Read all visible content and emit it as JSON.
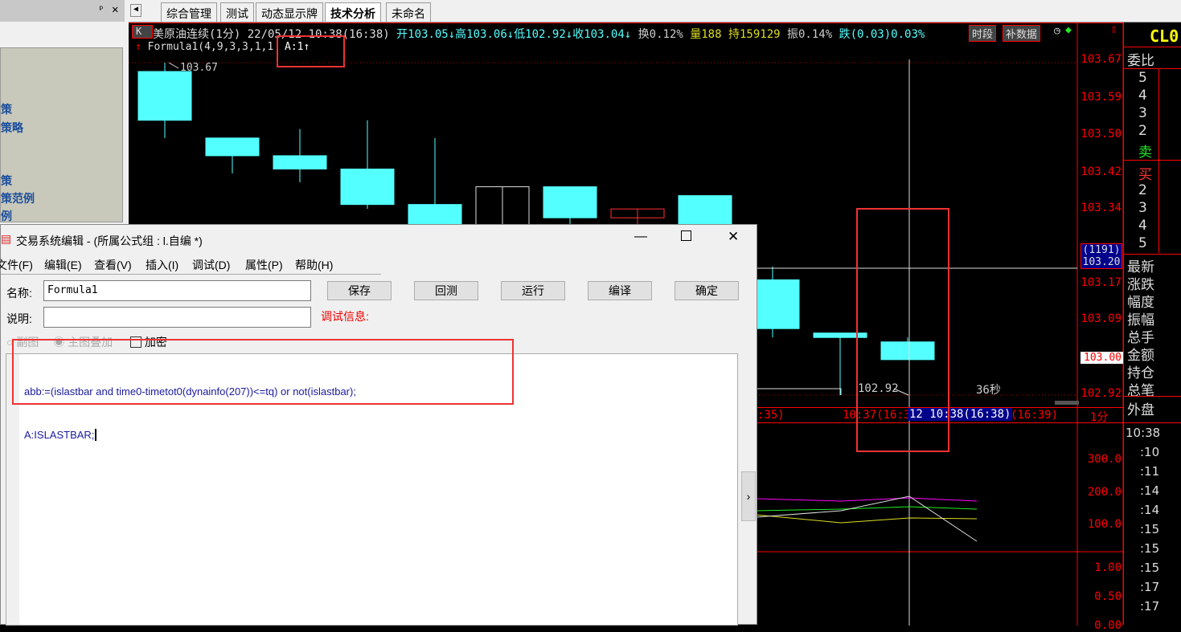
{
  "left_panel": {
    "items": [
      "策",
      "策略",
      "策",
      "策范例",
      "例"
    ]
  },
  "tabs": [
    "综合管理",
    "测试",
    "动态显示牌",
    "技术分析",
    "未命名"
  ],
  "active_tab": "技术分析",
  "chart": {
    "k_button": "K",
    "title": "美原油连续(1分) 22/05/12 10:38(16:38)",
    "open": "开103.05↓",
    "high": "高103.06↓",
    "low": "低102.92↓",
    "close": "收103.04↓",
    "turnover": "换0.12%",
    "volume": "量188",
    "hold": "持159129",
    "amplitude": "振0.14%",
    "change": "跌(0.03)0.03%",
    "btn_period": "时段",
    "btn_fill": "补数据",
    "formula": "Formula1(4,9,3,3,1,1",
    "formula_value": "A:1↑",
    "high_label": "103.67",
    "low_label": "102.92",
    "countdown": "36秒",
    "price_ticks": [
      "103.67",
      "103.59",
      "103.50",
      "103.42",
      "103.34",
      "103.17",
      "103.09",
      "102.92"
    ],
    "cursor_count": "(1191)",
    "cursor_price": "103.20",
    "last_price": "103.00",
    "time_axis": [
      ":35)",
      "10:37(16:37",
      "12 10:38(16:38)",
      "(16:39)"
    ],
    "period": "1分",
    "vol_ticks": [
      "300.0",
      "200.0",
      "100.0"
    ],
    "ind_ticks": [
      "1.00",
      "0.50",
      "0.00"
    ],
    "colors": {
      "up": "#ff3030",
      "down": "#54ffff",
      "grid": "#ff0000"
    }
  },
  "chart_data": {
    "type": "candlestick",
    "ylim": [
      102.92,
      103.67
    ],
    "candles": [
      {
        "o": 103.65,
        "h": 103.67,
        "l": 103.5,
        "c": 103.54
      },
      {
        "o": 103.5,
        "h": 103.5,
        "l": 103.42,
        "c": 103.46
      },
      {
        "o": 103.46,
        "h": 103.52,
        "l": 103.4,
        "c": 103.43
      },
      {
        "o": 103.43,
        "h": 103.54,
        "l": 103.34,
        "c": 103.35
      },
      {
        "o": 103.35,
        "h": 103.5,
        "l": 103.26,
        "c": 103.28
      },
      {
        "o": 103.28,
        "h": 103.39,
        "l": 103.28,
        "c": 103.39
      },
      {
        "o": 103.39,
        "h": 103.39,
        "l": 103.27,
        "c": 103.32
      },
      {
        "o": 103.32,
        "h": 103.34,
        "l": 103.27,
        "c": 103.34
      },
      {
        "o": 103.37,
        "h": 103.37,
        "l": 103.18,
        "c": 103.18
      },
      {
        "o": 103.18,
        "h": 103.21,
        "l": 103.05,
        "c": 103.07
      },
      {
        "o": 103.06,
        "h": 103.06,
        "l": 102.92,
        "c": 103.05
      },
      {
        "o": 103.04,
        "h": 103.05,
        "l": 103.0,
        "c": 103.0
      }
    ]
  },
  "right_panel": {
    "symbol": "CL0",
    "weibi": "委比",
    "sell": [
      "5",
      "4",
      "3",
      "2",
      "卖"
    ],
    "buy": [
      "买",
      "2",
      "3",
      "4",
      "5"
    ],
    "fields": [
      "最新",
      "涨跌",
      "幅度",
      "振幅",
      "总手",
      "金额",
      "持仓",
      "总笔"
    ],
    "outer": "外盘",
    "times": [
      "10:38",
      ":10",
      ":11",
      ":14",
      ":14",
      ":15",
      ":15",
      ":15",
      ":17",
      ":17"
    ]
  },
  "dialog": {
    "title": "交易系统编辑 - (所属公式组 : l.自编 *)",
    "menu": [
      "文件(F)",
      "编辑(E)",
      "查看(V)",
      "插入(I)",
      "调试(D)",
      "属性(P)",
      "帮助(H)"
    ],
    "name_label": "名称:",
    "name_value": "Formula1",
    "desc_label": "说明:",
    "desc_value": "",
    "buttons": [
      "保存",
      "回测",
      "运行",
      "编译",
      "确定"
    ],
    "debug_label": "调试信息:",
    "radio_sub": "副图",
    "radio_main": "主图叠加",
    "encrypt": "加密",
    "code_line1": "abb:=(islastbar and time0-timetot0(dynainfo(207))<=tq) or not(islastbar);",
    "code_line2": "A:ISLASTBAR;"
  }
}
